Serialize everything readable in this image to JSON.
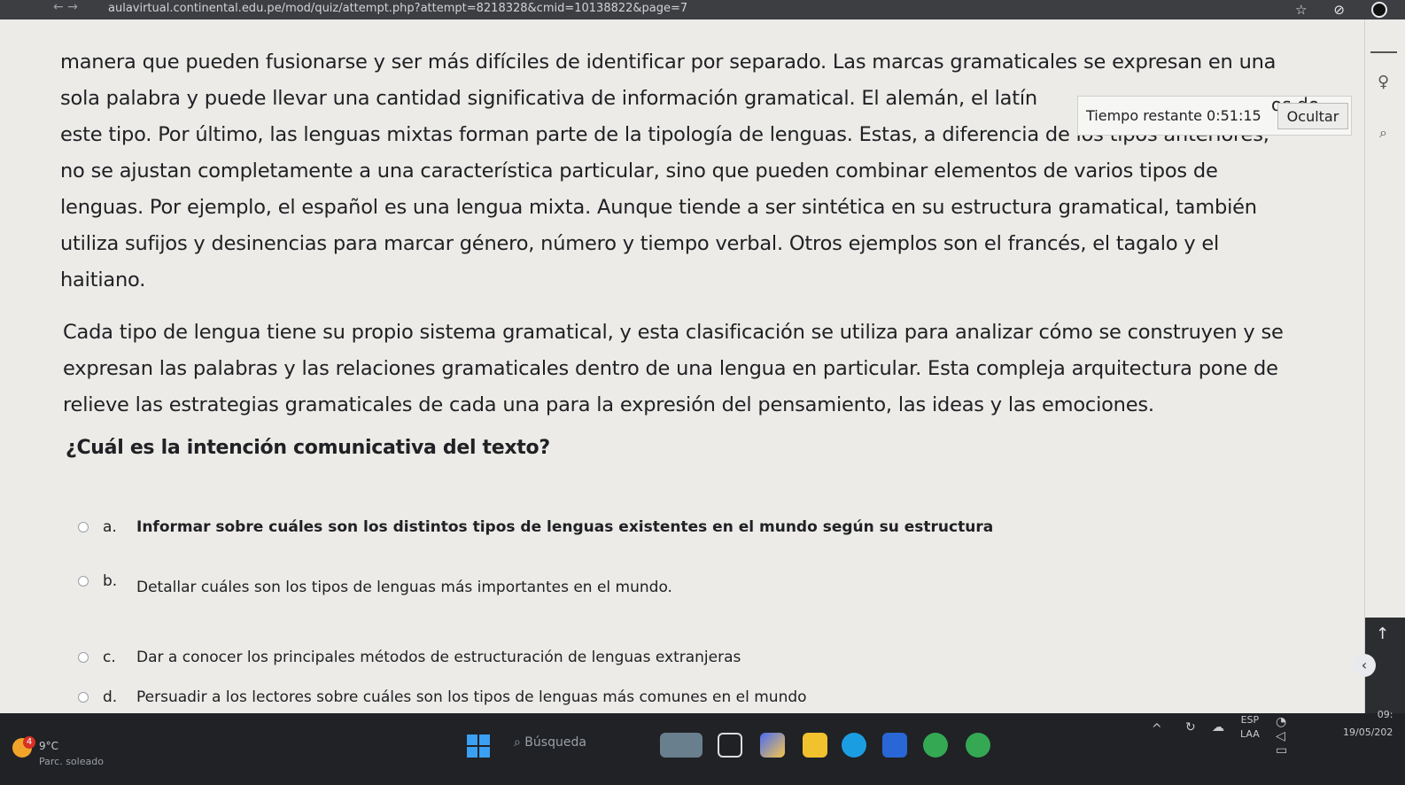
{
  "browser": {
    "url": "aulavirtual.continental.edu.pe/mod/quiz/attempt.php?attempt=8218328&cmid=10138822&page=7"
  },
  "reading": {
    "paragraph1_lines": [
      "manera que pueden fusionarse y ser más difíciles de identificar por separado. Las marcas gramaticales se expresan en una",
      "sola palabra y puede llevar una cantidad significativa de información gramatical. El alemán, el latín",
      "este tipo. Por último, las lenguas mixtas forman parte de la tipología de lenguas. Estas, a diferencia de los tipos anteriores,",
      "no se ajustan completamente a una característica particular, sino que pueden combinar elementos de varios tipos de",
      "lenguas. Por ejemplo, el español es una lengua mixta. Aunque tiende a ser sintética en su estructura gramatical, también",
      "utiliza sufijos y desinencias para marcar género, número y tiempo verbal. Otros ejemplos son el francés, el tagalo y el",
      "haitiano."
    ],
    "paragraph2_lines": [
      "Cada tipo de lengua tiene su propio sistema gramatical, y esta clasificación se utiliza para analizar cómo se construyen y se",
      "expresan las palabras y las relaciones gramaticales dentro de una lengua en particular. Esta compleja arquitectura pone de",
      "relieve las estrategias gramaticales de cada una para la expresión del pensamiento, las ideas y las emociones."
    ]
  },
  "quiz": {
    "question": "¿Cuál es la intención comunicativa del texto?",
    "options": [
      {
        "letter": "a.",
        "text": "Informar sobre cuáles son los distintos tipos de lenguas existentes en el mundo según su estructura"
      },
      {
        "letter": "b.",
        "text": "Detallar cuáles son los tipos de lenguas más importantes en el mundo."
      },
      {
        "letter": "c.",
        "text": "Dar a conocer los principales métodos de estructuración de lenguas extranjeras"
      },
      {
        "letter": "d.",
        "text": "Persuadir a los lectores sobre cuáles son los tipos de lenguas más comunes en el mundo"
      }
    ]
  },
  "timer": {
    "label": "Tiempo restante 0:51:15",
    "hide_button": "Ocultar",
    "partial_text": "os de"
  },
  "taskbar": {
    "weather_temp": "9°C",
    "weather_condition": "Parc. soleado",
    "weather_badge": "4",
    "search_placeholder": "Búsqueda",
    "lang_top": "ESP",
    "lang_bottom": "LAA",
    "time": "09:",
    "date": "19/05/202"
  },
  "colors": {
    "page_bg": "#ecebe8",
    "taskbar_bg": "#202226",
    "accent_blue": "#3aa0f3"
  }
}
